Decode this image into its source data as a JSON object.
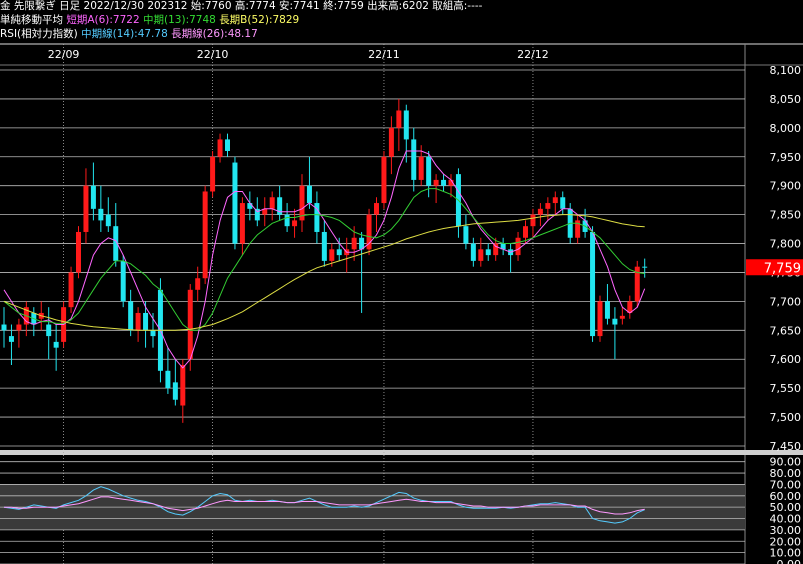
{
  "header": {
    "line1": "金 先限繋ぎ 日足 2022/12/30 202312 始:7760 高:7774 安:7741 終:7759 出来高:6202 取組高:----",
    "ma_title": "単純移動平均",
    "ma_short": "短期A(6):7722",
    "ma_mid": "中期(13):7748",
    "ma_long": "長期B(52):7829",
    "rsi_title": "RSI(相対力指数)",
    "rsi_mid": "中期線(14):47.78",
    "rsi_long": "長期線(26):48.17"
  },
  "colors": {
    "up": "#ff1a1a",
    "down": "#22e6f0",
    "ma_short": "#ff66ff",
    "ma_mid": "#33cc33",
    "ma_long": "#dddd44",
    "rsi14": "#55ccff",
    "rsi26": "#ff99ff",
    "last_price_bg": "#ff0000"
  },
  "chart_data": [
    {
      "type": "candlestick",
      "x_labels": [
        "22/09",
        "22/10",
        "22/11",
        "22/12"
      ],
      "y_ticks": [
        "7,450",
        "7,500",
        "7,550",
        "7,600",
        "7,650",
        "7,700",
        "7,750",
        "7,800",
        "7,850",
        "7,900",
        "7,950",
        "8,000",
        "8,050",
        "8,100"
      ],
      "ylim": [
        7450,
        8100
      ],
      "last_price_label": "7,759",
      "candles": [
        [
          7660,
          7690,
          7620,
          7650
        ],
        [
          7640,
          7660,
          7590,
          7630
        ],
        [
          7650,
          7670,
          7620,
          7660
        ],
        [
          7660,
          7700,
          7640,
          7690
        ],
        [
          7680,
          7690,
          7640,
          7660
        ],
        [
          7670,
          7700,
          7650,
          7680
        ],
        [
          7660,
          7690,
          7600,
          7640
        ],
        [
          7630,
          7660,
          7580,
          7620
        ],
        [
          7630,
          7700,
          7620,
          7690
        ],
        [
          7690,
          7760,
          7680,
          7750
        ],
        [
          7750,
          7830,
          7740,
          7820
        ],
        [
          7820,
          7930,
          7800,
          7900
        ],
        [
          7900,
          7940,
          7840,
          7860
        ],
        [
          7860,
          7900,
          7820,
          7840
        ],
        [
          7850,
          7880,
          7820,
          7830
        ],
        [
          7830,
          7870,
          7760,
          7770
        ],
        [
          7770,
          7780,
          7690,
          7700
        ],
        [
          7700,
          7720,
          7640,
          7650
        ],
        [
          7650,
          7690,
          7630,
          7680
        ],
        [
          7680,
          7700,
          7620,
          7650
        ],
        [
          7650,
          7680,
          7620,
          7640
        ],
        [
          7720,
          7740,
          7560,
          7580
        ],
        [
          7580,
          7620,
          7540,
          7550
        ],
        [
          7560,
          7600,
          7520,
          7530
        ],
        [
          7520,
          7600,
          7490,
          7590
        ],
        [
          7600,
          7730,
          7580,
          7720
        ],
        [
          7720,
          7760,
          7700,
          7740
        ],
        [
          7740,
          7900,
          7730,
          7890
        ],
        [
          7890,
          7960,
          7880,
          7950
        ],
        [
          7950,
          7990,
          7940,
          7980
        ],
        [
          7980,
          7990,
          7950,
          7960
        ],
        [
          7940,
          7950,
          7790,
          7800
        ],
        [
          7800,
          7880,
          7780,
          7870
        ],
        [
          7870,
          7890,
          7840,
          7860
        ],
        [
          7860,
          7880,
          7830,
          7840
        ],
        [
          7850,
          7880,
          7830,
          7860
        ],
        [
          7860,
          7890,
          7840,
          7880
        ],
        [
          7880,
          7900,
          7840,
          7850
        ],
        [
          7850,
          7870,
          7820,
          7830
        ],
        [
          7830,
          7860,
          7810,
          7840
        ],
        [
          7840,
          7920,
          7820,
          7900
        ],
        [
          7900,
          7950,
          7860,
          7870
        ],
        [
          7870,
          7890,
          7800,
          7820
        ],
        [
          7820,
          7840,
          7760,
          7770
        ],
        [
          7770,
          7800,
          7760,
          7790
        ],
        [
          7790,
          7810,
          7770,
          7780
        ],
        [
          7780,
          7810,
          7750,
          7790
        ],
        [
          7790,
          7830,
          7770,
          7810
        ],
        [
          7810,
          7820,
          7680,
          7790
        ],
        [
          7790,
          7860,
          7780,
          7850
        ],
        [
          7850,
          7880,
          7820,
          7870
        ],
        [
          7870,
          7960,
          7860,
          7950
        ],
        [
          7950,
          8020,
          7920,
          8000
        ],
        [
          8000,
          8050,
          7960,
          8030
        ],
        [
          8030,
          8040,
          7940,
          7980
        ],
        [
          7980,
          8000,
          7890,
          7910
        ],
        [
          7910,
          7970,
          7900,
          7950
        ],
        [
          7950,
          7960,
          7880,
          7900
        ],
        [
          7900,
          7920,
          7870,
          7910
        ],
        [
          7910,
          7920,
          7890,
          7900
        ],
        [
          7900,
          7920,
          7880,
          7910
        ],
        [
          7920,
          7930,
          7810,
          7830
        ],
        [
          7830,
          7850,
          7790,
          7800
        ],
        [
          7800,
          7810,
          7760,
          7770
        ],
        [
          7770,
          7810,
          7760,
          7790
        ],
        [
          7790,
          7800,
          7770,
          7780
        ],
        [
          7780,
          7810,
          7770,
          7800
        ],
        [
          7800,
          7810,
          7780,
          7790
        ],
        [
          7790,
          7800,
          7750,
          7780
        ],
        [
          7780,
          7820,
          7770,
          7810
        ],
        [
          7810,
          7840,
          7800,
          7830
        ],
        [
          7830,
          7860,
          7810,
          7850
        ],
        [
          7850,
          7870,
          7830,
          7860
        ],
        [
          7860,
          7880,
          7840,
          7870
        ],
        [
          7870,
          7890,
          7850,
          7880
        ],
        [
          7880,
          7890,
          7850,
          7860
        ],
        [
          7860,
          7870,
          7800,
          7810
        ],
        [
          7810,
          7850,
          7800,
          7840
        ],
        [
          7840,
          7860,
          7810,
          7820
        ],
        [
          7820,
          7830,
          7630,
          7640
        ],
        [
          7640,
          7710,
          7630,
          7700
        ],
        [
          7700,
          7730,
          7660,
          7670
        ],
        [
          7670,
          7690,
          7600,
          7660
        ],
        [
          7670,
          7690,
          7660,
          7675
        ],
        [
          7680,
          7710,
          7670,
          7700
        ],
        [
          7700,
          7770,
          7690,
          7760
        ],
        [
          7760,
          7774,
          7741,
          7759
        ]
      ],
      "series": [
        {
          "name": "短期A(6)",
          "values": [
            7720,
            7700,
            7680,
            7665,
            7660,
            7665,
            7668,
            7660,
            7660,
            7670,
            7700,
            7740,
            7780,
            7800,
            7810,
            7805,
            7780,
            7750,
            7720,
            7690,
            7670,
            7650,
            7620,
            7600,
            7585,
            7600,
            7640,
            7700,
            7780,
            7840,
            7880,
            7890,
            7890,
            7870,
            7855,
            7860,
            7860,
            7855,
            7855,
            7855,
            7860,
            7870,
            7860,
            7840,
            7820,
            7800,
            7785,
            7785,
            7790,
            7800,
            7815,
            7840,
            7880,
            7930,
            7960,
            7960,
            7960,
            7955,
            7935,
            7920,
            7910,
            7890,
            7870,
            7845,
            7825,
            7810,
            7795,
            7790,
            7785,
            7790,
            7800,
            7810,
            7825,
            7840,
            7850,
            7860,
            7860,
            7850,
            7840,
            7820,
            7790,
            7760,
            7720,
            7690,
            7680,
            7690,
            7722
          ]
        },
        {
          "name": "中期(13)",
          "values": [
            7700,
            7690,
            7680,
            7675,
            7670,
            7665,
            7665,
            7662,
            7662,
            7668,
            7680,
            7700,
            7720,
            7740,
            7755,
            7770,
            7770,
            7765,
            7755,
            7745,
            7730,
            7720,
            7700,
            7680,
            7660,
            7650,
            7650,
            7660,
            7680,
            7710,
            7740,
            7760,
            7780,
            7800,
            7815,
            7825,
            7835,
            7840,
            7845,
            7845,
            7848,
            7850,
            7850,
            7848,
            7845,
            7840,
            7830,
            7820,
            7815,
            7812,
            7810,
            7815,
            7825,
            7840,
            7860,
            7880,
            7890,
            7895,
            7895,
            7890,
            7885,
            7875,
            7860,
            7845,
            7830,
            7815,
            7805,
            7800,
            7800,
            7802,
            7805,
            7810,
            7815,
            7820,
            7825,
            7830,
            7835,
            7835,
            7830,
            7820,
            7810,
            7795,
            7780,
            7765,
            7755,
            7750,
            7748
          ]
        },
        {
          "name": "長期B(52)",
          "values": [
            7700,
            7695,
            7690,
            7685,
            7680,
            7675,
            7672,
            7668,
            7665,
            7662,
            7660,
            7658,
            7656,
            7655,
            7654,
            7653,
            7652,
            7651,
            7650,
            7650,
            7650,
            7650,
            7650,
            7650,
            7651,
            7652,
            7654,
            7657,
            7660,
            7665,
            7670,
            7676,
            7682,
            7690,
            7698,
            7706,
            7714,
            7722,
            7730,
            7738,
            7745,
            7752,
            7758,
            7762,
            7766,
            7770,
            7774,
            7778,
            7782,
            7786,
            7790,
            7794,
            7798,
            7803,
            7808,
            7812,
            7816,
            7820,
            7823,
            7826,
            7828,
            7830,
            7832,
            7834,
            7835,
            7836,
            7837,
            7838,
            7839,
            7840,
            7842,
            7844,
            7846,
            7848,
            7849,
            7850,
            7850,
            7849,
            7848,
            7846,
            7843,
            7840,
            7837,
            7834,
            7832,
            7830,
            7829
          ]
        }
      ]
    },
    {
      "type": "line",
      "y_ticks": [
        "0.00",
        "10.00",
        "20.00",
        "30.00",
        "40.00",
        "50.00",
        "60.00",
        "70.00",
        "80.00",
        "90.00"
      ],
      "ylim": [
        0,
        95
      ],
      "series": [
        {
          "name": "中期線(14)",
          "values": [
            50,
            49,
            48,
            50,
            52,
            51,
            50,
            49,
            52,
            54,
            56,
            60,
            65,
            68,
            66,
            63,
            60,
            58,
            56,
            55,
            53,
            50,
            46,
            44,
            43,
            46,
            50,
            55,
            60,
            62,
            61,
            56,
            55,
            56,
            55,
            55,
            56,
            55,
            54,
            54,
            56,
            58,
            55,
            52,
            50,
            50,
            50,
            51,
            50,
            51,
            54,
            57,
            60,
            63,
            62,
            58,
            56,
            55,
            55,
            55,
            55,
            52,
            50,
            49,
            49,
            49,
            49,
            50,
            49,
            50,
            51,
            52,
            53,
            53,
            54,
            53,
            52,
            50,
            50,
            40,
            38,
            37,
            36,
            37,
            40,
            45,
            47.78
          ]
        },
        {
          "name": "長期線(26)",
          "values": [
            50,
            50,
            49,
            49,
            50,
            50,
            50,
            50,
            51,
            52,
            53,
            55,
            57,
            59,
            59,
            58,
            57,
            56,
            55,
            54,
            53,
            51,
            49,
            48,
            47,
            48,
            49,
            51,
            53,
            55,
            56,
            55,
            55,
            55,
            55,
            55,
            55,
            55,
            54,
            54,
            55,
            55,
            55,
            54,
            53,
            52,
            52,
            52,
            52,
            52,
            53,
            54,
            55,
            56,
            57,
            56,
            55,
            55,
            54,
            54,
            54,
            53,
            52,
            51,
            51,
            50,
            50,
            50,
            50,
            50,
            51,
            51,
            52,
            52,
            52,
            52,
            52,
            51,
            51,
            48,
            46,
            45,
            44,
            44,
            45,
            47,
            48.17
          ]
        }
      ]
    }
  ]
}
